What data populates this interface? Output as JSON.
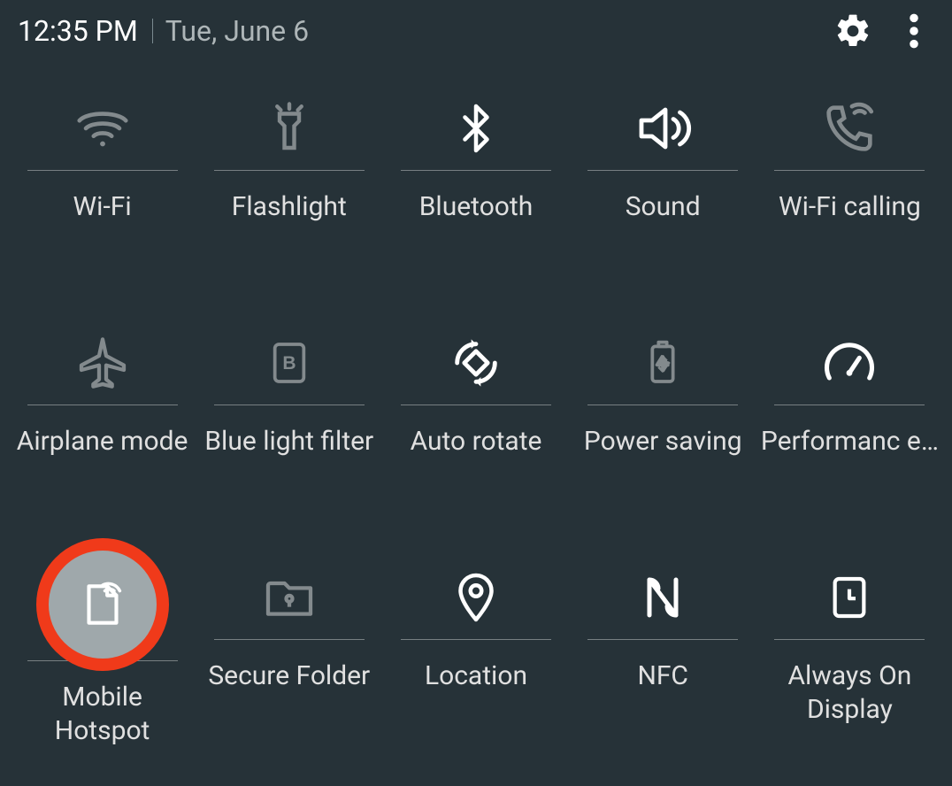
{
  "header": {
    "time": "12:35 PM",
    "date": "Tue, June 6"
  },
  "tiles": [
    {
      "label": "Wi-Fi"
    },
    {
      "label": "Flashlight"
    },
    {
      "label": "Bluetooth"
    },
    {
      "label": "Sound"
    },
    {
      "label": "Wi-Fi calling"
    },
    {
      "label": "Airplane mode"
    },
    {
      "label": "Blue light filter"
    },
    {
      "label": "Auto rotate"
    },
    {
      "label": "Power saving"
    },
    {
      "label": "Performanc e…"
    },
    {
      "label": "Mobile Hotspot"
    },
    {
      "label": "Secure Folder"
    },
    {
      "label": "Location"
    },
    {
      "label": "NFC"
    },
    {
      "label": "Always On Display"
    }
  ]
}
